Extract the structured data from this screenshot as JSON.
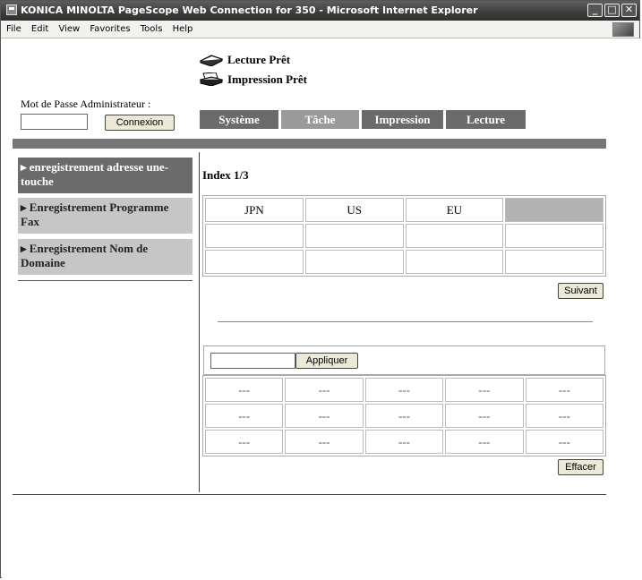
{
  "window": {
    "title": "KONICA MINOLTA PageScope Web Connection for 350 - Microsoft Internet Explorer"
  },
  "menubar": [
    "File",
    "Edit",
    "View",
    "Favorites",
    "Tools",
    "Help"
  ],
  "status": {
    "scan": "Lecture Prêt",
    "print": "Impression Prêt"
  },
  "admin": {
    "label": "Mot de Passe Administrateur :",
    "password_value": "",
    "login_button": "Connexion"
  },
  "tabs": [
    {
      "label": "Système",
      "active": true
    },
    {
      "label": "Tâche",
      "active": false
    },
    {
      "label": "Impression",
      "active": true
    },
    {
      "label": "Lecture",
      "active": true
    }
  ],
  "sidebar": [
    {
      "label": "enregistrement adresse une-touche",
      "active": true
    },
    {
      "label": "Enregistrement Programme Fax",
      "active": false
    },
    {
      "label": "Enregistrement Nom de Domaine",
      "active": false
    }
  ],
  "index_label": "Index 1/3",
  "index_tabs": [
    "JPN",
    "US",
    "EU",
    ""
  ],
  "index_empty_rows": [
    [
      "",
      "",
      "",
      ""
    ],
    [
      "",
      "",
      "",
      ""
    ]
  ],
  "next_button": "Suivant",
  "apply": {
    "input_value": "",
    "button": "Appliquer"
  },
  "result_rows": [
    [
      "---",
      "---",
      "---",
      "---",
      "---"
    ],
    [
      "---",
      "---",
      "---",
      "---",
      "---"
    ],
    [
      "---",
      "---",
      "---",
      "---",
      "---"
    ]
  ],
  "clear_button": "Effacer",
  "colors": {
    "tab_active": "#6b6b6b",
    "tab_inactive": "#9a9a9a",
    "sidebar_active": "#6b6b6b",
    "sidebar_inactive": "#c6c6c6",
    "greybar": "#777777",
    "selected_cell": "#b3b3b3"
  }
}
